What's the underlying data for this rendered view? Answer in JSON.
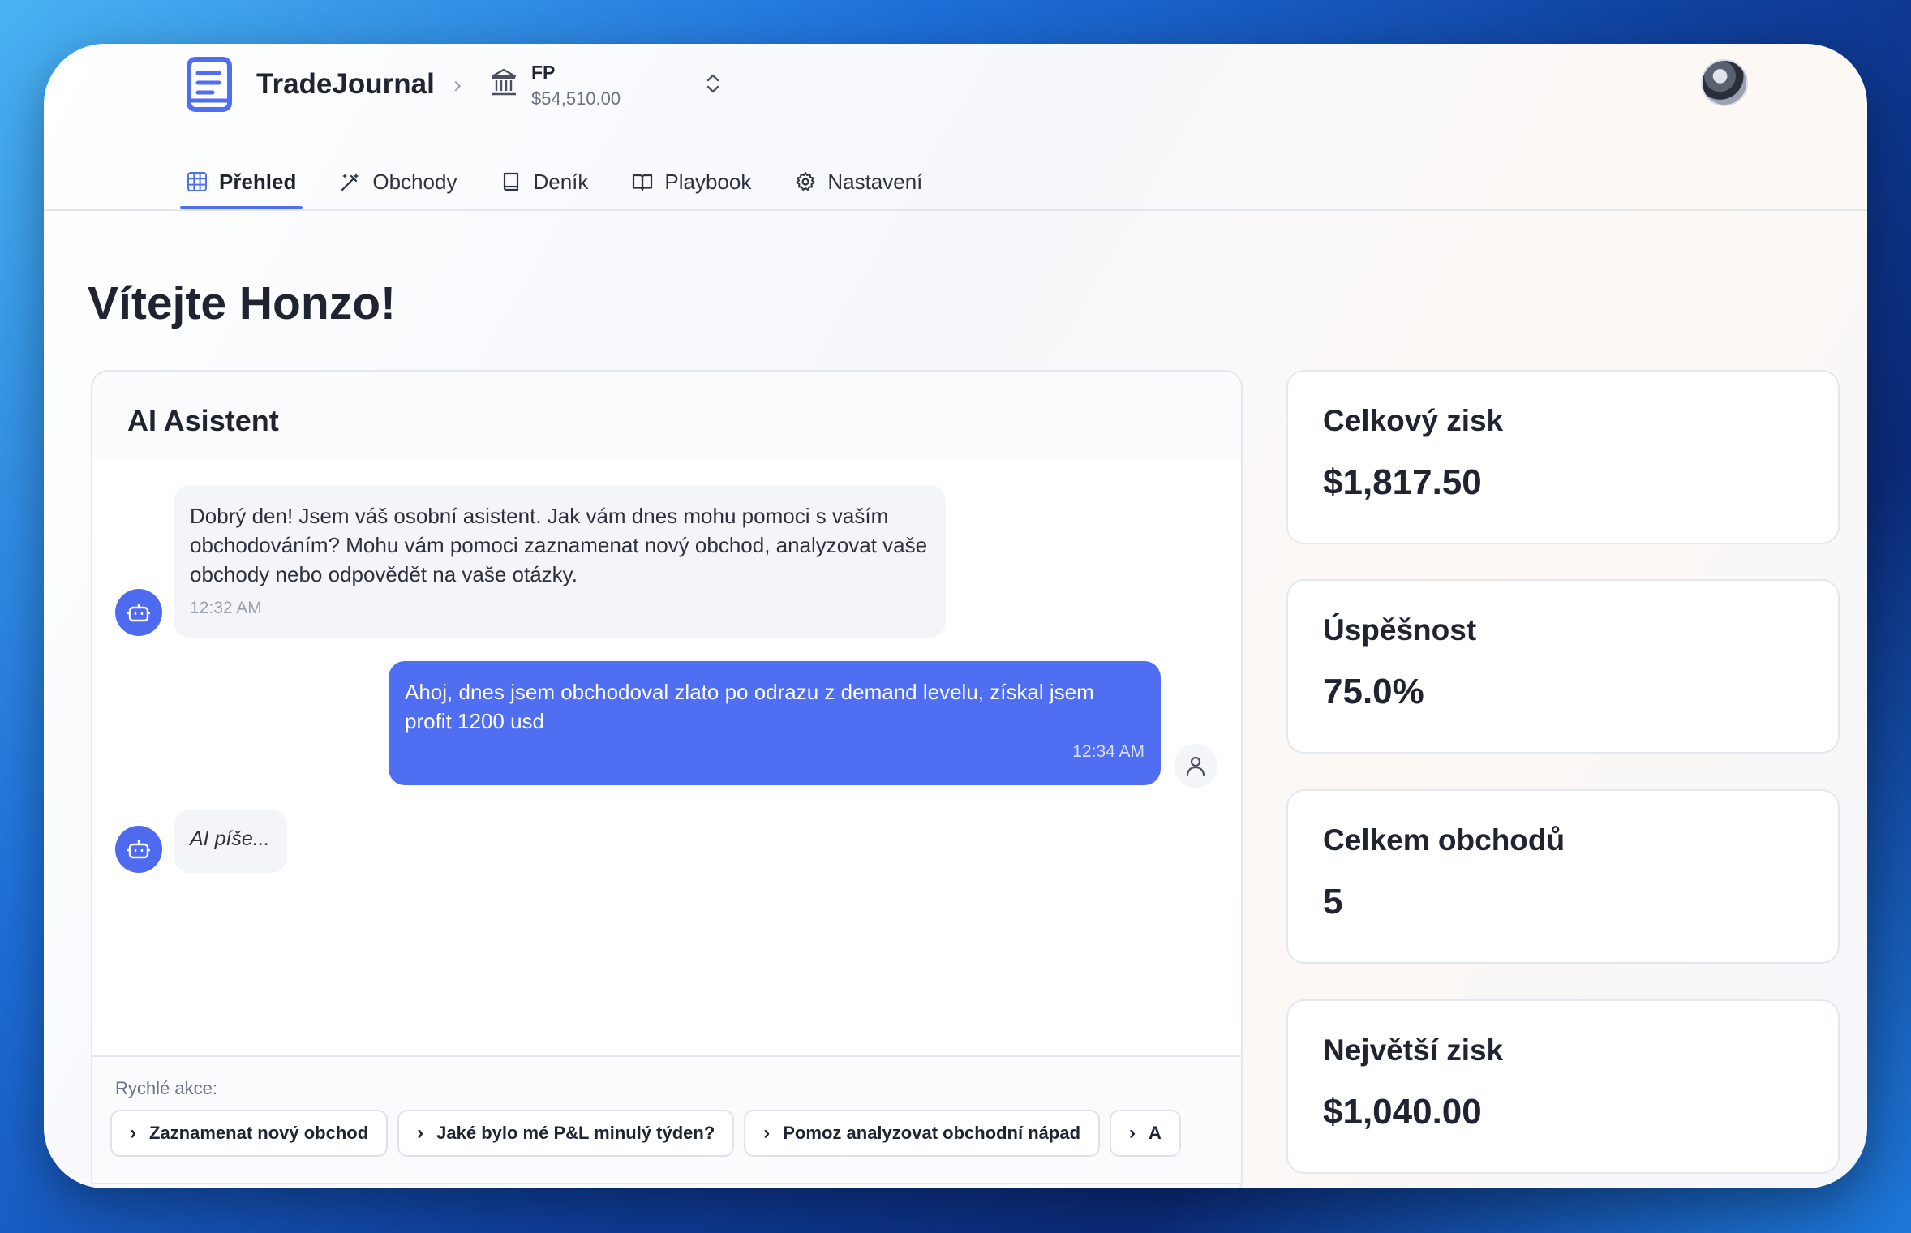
{
  "app": {
    "name": "TradeJournal",
    "breadcrumb_separator": "›"
  },
  "account": {
    "name": "FP",
    "balance": "$54,510.00"
  },
  "tabs": [
    {
      "label": "Přehled",
      "icon": "grid-icon",
      "active": true
    },
    {
      "label": "Obchody",
      "icon": "magic-wand-icon",
      "active": false
    },
    {
      "label": "Deník",
      "icon": "notebook-icon",
      "active": false
    },
    {
      "label": "Playbook",
      "icon": "open-book-icon",
      "active": false
    },
    {
      "label": "Nastavení",
      "icon": "gear-icon",
      "active": false
    }
  ],
  "welcome": "Vítejte Honzo!",
  "chat": {
    "title": "AI Asistent",
    "messages": [
      {
        "from": "bot",
        "text": "Dobrý den! Jsem váš osobní asistent. Jak vám dnes mohu pomoci s vaším obchodováním? Mohu vám pomoci zaznamenat nový obchod, analyzovat vaše obchody nebo odpovědět na vaše otázky.",
        "time": "12:32 AM"
      },
      {
        "from": "user",
        "text": "Ahoj, dnes jsem obchodoval zlato po odrazu z demand levelu, získal jsem profit 1200 usd",
        "time": "12:34 AM"
      },
      {
        "from": "bot",
        "text": "AI píše..."
      }
    ],
    "quick_label": "Rychlé akce:",
    "quick_actions": [
      "Zaznamenat nový obchod",
      "Jaké bylo mé P&L minulý týden?",
      "Pomoz analyzovat obchodní nápad",
      "A"
    ]
  },
  "stats": [
    {
      "label": "Celkový zisk",
      "value": "$1,817.50"
    },
    {
      "label": "Úspěšnost",
      "value": "75.0%"
    },
    {
      "label": "Celkem obchodů",
      "value": "5"
    },
    {
      "label": "Největší zisk",
      "value": "$1,040.00"
    }
  ],
  "colors": {
    "accent": "#4f6ef2",
    "text": "#1f2430",
    "muted": "#6b7280"
  }
}
